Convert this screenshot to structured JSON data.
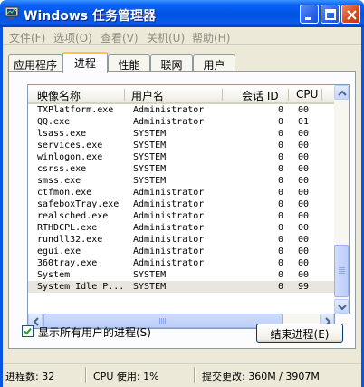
{
  "window": {
    "title": "Windows 任务管理器",
    "controls": [
      "minimize",
      "maximize",
      "close"
    ]
  },
  "menu": [
    "文件(F)",
    "选项(O)",
    "查看(V)",
    "关机(U)",
    "帮助(H)"
  ],
  "tabs": [
    "应用程序",
    "进程",
    "性能",
    "联网",
    "用户"
  ],
  "active_tab": "进程",
  "columns": {
    "name": "映像名称",
    "user": "用户名",
    "session": "会话 ID",
    "cpu": "CPU"
  },
  "processes": [
    {
      "name": "TXPlatform.exe",
      "user": "Administrator",
      "session": "0",
      "cpu": "00"
    },
    {
      "name": "QQ.exe",
      "user": "Administrator",
      "session": "0",
      "cpu": "01"
    },
    {
      "name": "lsass.exe",
      "user": "SYSTEM",
      "session": "0",
      "cpu": "00"
    },
    {
      "name": "services.exe",
      "user": "SYSTEM",
      "session": "0",
      "cpu": "00"
    },
    {
      "name": "winlogon.exe",
      "user": "SYSTEM",
      "session": "0",
      "cpu": "00"
    },
    {
      "name": "csrss.exe",
      "user": "SYSTEM",
      "session": "0",
      "cpu": "00"
    },
    {
      "name": "smss.exe",
      "user": "SYSTEM",
      "session": "0",
      "cpu": "00"
    },
    {
      "name": "ctfmon.exe",
      "user": "Administrator",
      "session": "0",
      "cpu": "00"
    },
    {
      "name": "safeboxTray.exe",
      "user": "Administrator",
      "session": "0",
      "cpu": "00"
    },
    {
      "name": "realsched.exe",
      "user": "Administrator",
      "session": "0",
      "cpu": "00"
    },
    {
      "name": "RTHDCPL.exe",
      "user": "Administrator",
      "session": "0",
      "cpu": "00"
    },
    {
      "name": "rundll32.exe",
      "user": "Administrator",
      "session": "0",
      "cpu": "00"
    },
    {
      "name": "egui.exe",
      "user": "Administrator",
      "session": "0",
      "cpu": "00"
    },
    {
      "name": "360tray.exe",
      "user": "Administrator",
      "session": "0",
      "cpu": "00"
    },
    {
      "name": "System",
      "user": "SYSTEM",
      "session": "0",
      "cpu": "00"
    },
    {
      "name": "System Idle P...",
      "user": "SYSTEM",
      "session": "0",
      "cpu": "99"
    }
  ],
  "show_all_users": {
    "label": "显示所有用户的进程(S)",
    "checked": true
  },
  "end_process_label": "结束进程(E)",
  "status": {
    "processes": "进程数: 32",
    "cpu_usage": "CPU 使用: 1%",
    "commit": "提交更改: 360M / 3907M"
  },
  "colors": {
    "titlebar": "#0054e3",
    "active_tab_accent": "#ffc73c",
    "face": "#ece9d8"
  }
}
